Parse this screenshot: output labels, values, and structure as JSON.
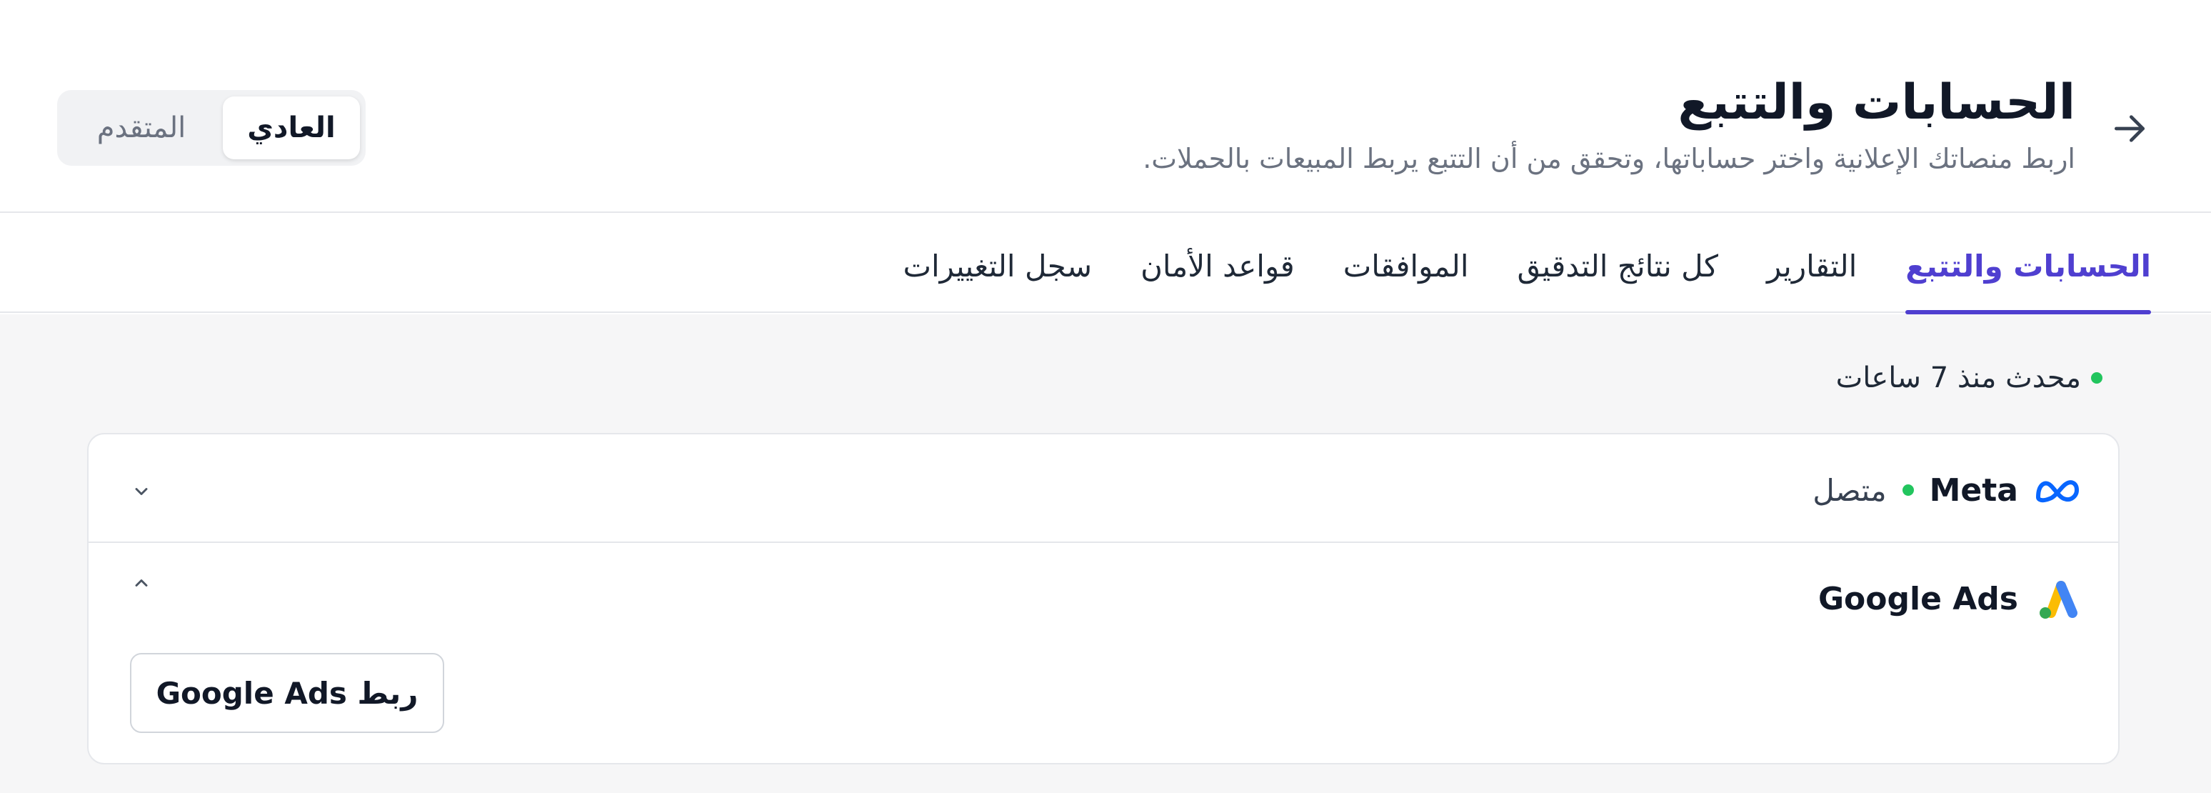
{
  "header": {
    "title": "الحسابات والتتبع",
    "subtitle": "اربط منصاتك الإعلانية واختر حساباتها، وتحقق من أن التتبع يربط المبيعات بالحملات.",
    "back_icon": "arrow-right-icon"
  },
  "mode_toggle": {
    "active_label": "العادي",
    "inactive_label": "المتقدم"
  },
  "tabs": [
    {
      "label": "الحسابات والتتبع",
      "active": true
    },
    {
      "label": "التقارير",
      "active": false
    },
    {
      "label": "كل نتائج التدقيق",
      "active": false
    },
    {
      "label": "الموافقات",
      "active": false
    },
    {
      "label": "قواعد الأمان",
      "active": false
    },
    {
      "label": "سجل التغييرات",
      "active": false
    }
  ],
  "status": {
    "updated_text": "محدث منذ 7 ساعات",
    "dot_color": "#22c55e"
  },
  "platforms": [
    {
      "name": "Meta",
      "icon": "meta-logo-icon",
      "status_text": "متصل",
      "status_color": "#22c55e",
      "expanded": false
    },
    {
      "name": "Google Ads",
      "icon": "google-ads-logo-icon",
      "status_text": "",
      "expanded": true,
      "connect_label": "ربط Google Ads"
    }
  ],
  "colors": {
    "accent": "#4f3fd0",
    "success": "#22c55e",
    "meta_blue": "#0866ff",
    "google_blue": "#4285f4",
    "google_yellow": "#fbbc04"
  }
}
